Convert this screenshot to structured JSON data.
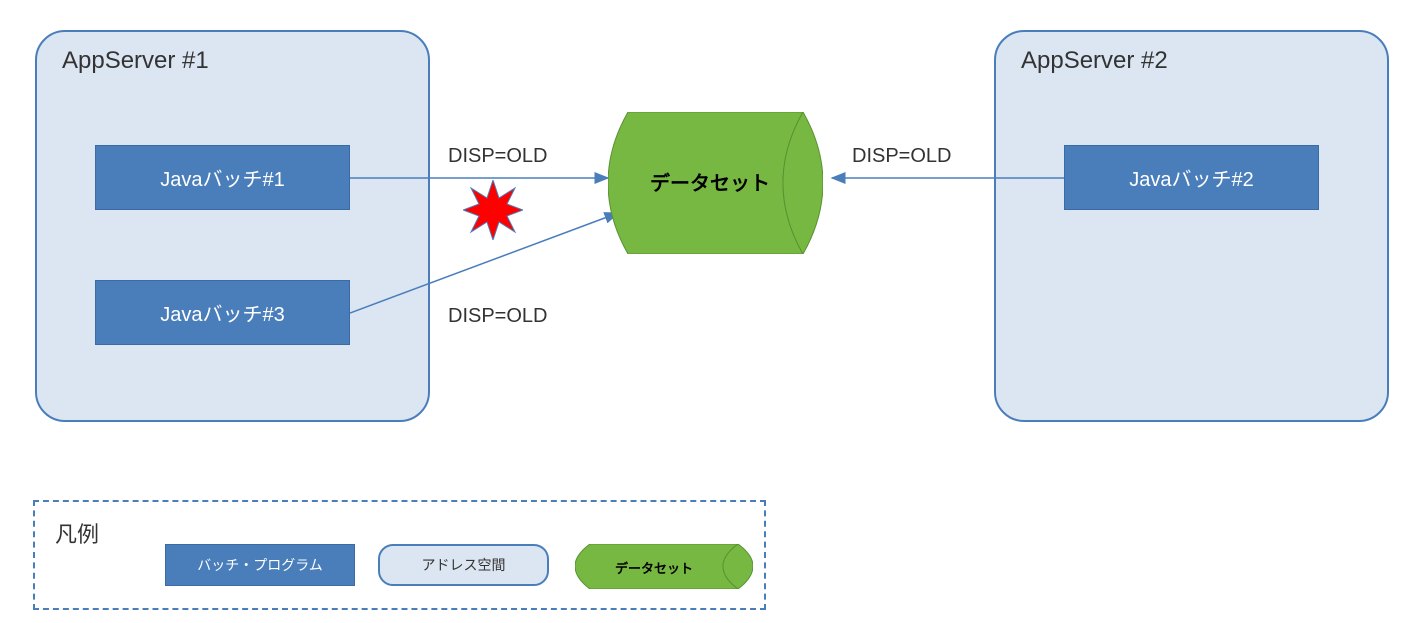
{
  "server1": {
    "title": "AppServer #1"
  },
  "server2": {
    "title": "AppServer #2"
  },
  "batches": {
    "b1": "Javaバッチ#1",
    "b2": "Javaバッチ#2",
    "b3": "Javaバッチ#3"
  },
  "dataset": {
    "label": "データセット"
  },
  "disp": {
    "l1": "DISP=OLD",
    "l2": "DISP=OLD",
    "l3": "DISP=OLD"
  },
  "legend": {
    "title": "凡例",
    "batch": "バッチ・プログラム",
    "addr": "アドレス空間",
    "ds": "データセット"
  }
}
